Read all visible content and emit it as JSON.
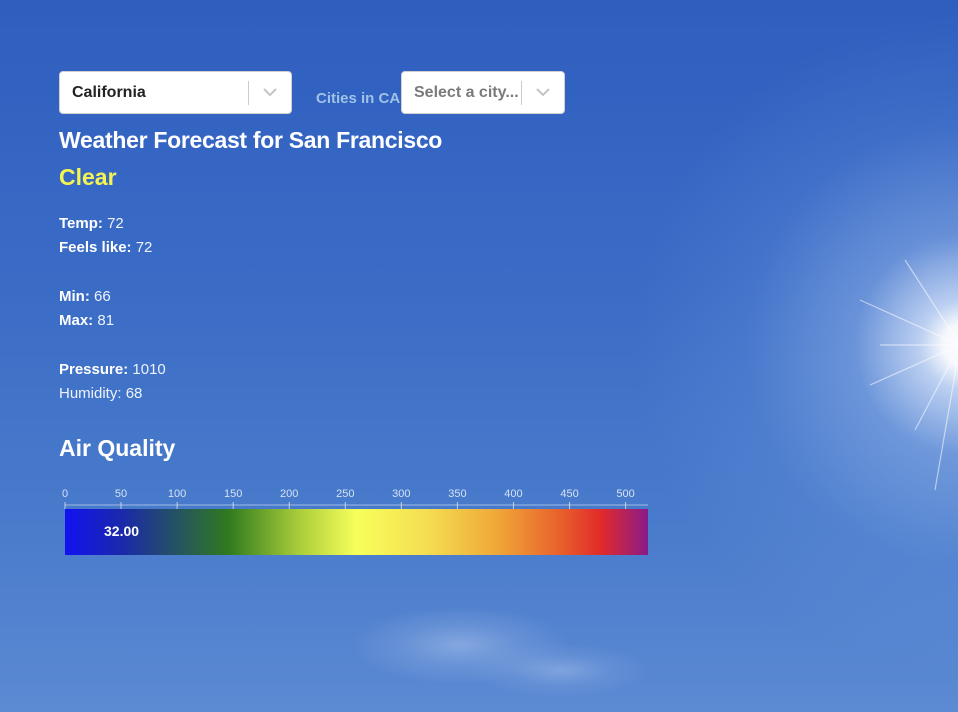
{
  "state_select": {
    "value": "California"
  },
  "city_select": {
    "label": "Cities in CA",
    "placeholder": "Select a city..."
  },
  "forecast": {
    "title": "Weather Forecast for San Francisco",
    "condition": "Clear",
    "stats": [
      {
        "label": "Temp:",
        "value": "72"
      },
      {
        "label": "Feels like:",
        "value": "72"
      },
      {
        "label": "Min:",
        "value": "66"
      },
      {
        "label": "Max:",
        "value": "81"
      },
      {
        "label": "Pressure:",
        "value": "1010"
      },
      {
        "label": "Humidity:",
        "value": "68"
      }
    ]
  },
  "air_quality": {
    "title": "Air Quality",
    "value_text": "32.00",
    "value": 32,
    "scale_min": 0,
    "scale_max": 520,
    "ticks": [
      "0",
      "50",
      "100",
      "150",
      "200",
      "250",
      "300",
      "350",
      "400",
      "450",
      "500"
    ]
  },
  "colors": {
    "accent_condition": "#f5f552",
    "cities_label": "#9fc2e6",
    "sky_top": "#2f5ebf",
    "sky_bottom": "#5c8ad3"
  },
  "icons": {
    "dropdown": "chevron-down-icon"
  }
}
